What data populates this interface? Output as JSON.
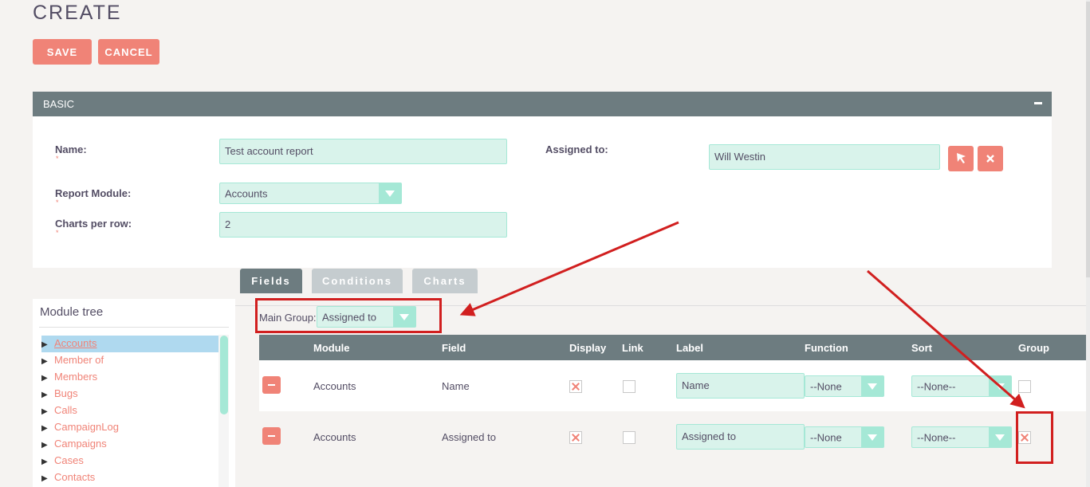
{
  "page": {
    "title": "CREATE"
  },
  "actions": {
    "save": "SAVE",
    "cancel": "CANCEL"
  },
  "basic": {
    "header": "BASIC",
    "name_label": "Name:",
    "name_value": "Test account report",
    "assigned_label": "Assigned to:",
    "assigned_value": "Will Westin",
    "module_label": "Report Module:",
    "module_value": "Accounts",
    "charts_label": "Charts per row:",
    "charts_value": "2",
    "required_mark": "*"
  },
  "tabs": [
    "Fields",
    "Conditions",
    "Charts"
  ],
  "module_tree": {
    "title": "Module tree",
    "items": [
      "Accounts",
      "Member of",
      "Members",
      "Bugs",
      "Calls",
      "CampaignLog",
      "Campaigns",
      "Cases",
      "Contacts"
    ],
    "selected_index": 0
  },
  "main_group": {
    "label": "Main Group:",
    "value": "Assigned to"
  },
  "fields_table": {
    "columns": [
      "Module",
      "Field",
      "Display",
      "Link",
      "Label",
      "Function",
      "Sort",
      "Group"
    ],
    "rows": [
      {
        "module": "Accounts",
        "field": "Name",
        "display": true,
        "link": false,
        "label": "Name",
        "function": "--None",
        "sort": "--None--",
        "group": false
      },
      {
        "module": "Accounts",
        "field": "Assigned to",
        "display": true,
        "link": false,
        "label": "Assigned to",
        "function": "--None",
        "sort": "--None--",
        "group": true
      }
    ]
  },
  "colors": {
    "accent": "#f08377",
    "header": "#6d7c80",
    "input_bg": "#d9f3eb",
    "input_border": "#a5e8d6",
    "annotation": "#d11f1f"
  }
}
